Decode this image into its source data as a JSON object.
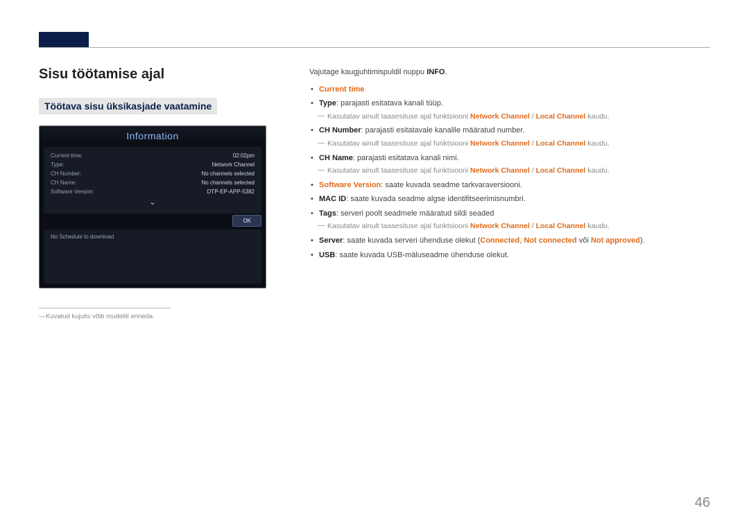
{
  "page_number": "46",
  "heading_main": "Sisu töötamise ajal",
  "heading_sub": "Töötava sisu üksikasjade vaatamine",
  "device": {
    "title": "Information",
    "rows": [
      {
        "label": "Current time:",
        "value": "02:02pm"
      },
      {
        "label": "Type:",
        "value": "Network Channel"
      },
      {
        "label": "CH Number:",
        "value": "No channels selected"
      },
      {
        "label": "CH Name:",
        "value": "No channels selected"
      },
      {
        "label": "Software Version:",
        "value": "DTP-EP-APP-5382"
      }
    ],
    "ok_label": "OK",
    "schedule_text": "No Schedule to download"
  },
  "footnote": "Kuvatud kujutis võib mudeliti erineda.",
  "intro_pre": "Vajutage kaugjuhtimispuldil nuppu ",
  "intro_bold": "INFO",
  "intro_post": ".",
  "items": [
    {
      "lead_orange": "Current time",
      "rest": ""
    },
    {
      "lead_bold": "Type",
      "rest": ": parajasti esitatava kanali tüüp.",
      "sub_pre": "Kasutatav ainult taasesituse ajal funktsiooni ",
      "sub_orange1": "Network Channel",
      "sub_mid": " / ",
      "sub_orange2": "Local Channel",
      "sub_post": " kaudu."
    },
    {
      "lead_bold": "CH Number",
      "rest": ": parajasti esitatavale kanalile määratud number.",
      "sub_pre": "Kasutatav ainult taasesituse ajal funktsiooni ",
      "sub_orange1": "Network Channel",
      "sub_mid": " / ",
      "sub_orange2": "Local Channel",
      "sub_post": " kaudu."
    },
    {
      "lead_bold": "CH Name",
      "rest": ": parajasti esitatava kanali nimi.",
      "sub_pre": "Kasutatav ainult taasesituse ajal funktsiooni ",
      "sub_orange1": "Network Channel",
      "sub_mid": " / ",
      "sub_orange2": "Local Channel",
      "sub_post": " kaudu."
    },
    {
      "lead_orange": "Software Version",
      "rest": ": saate kuvada seadme tarkvaraversiooni."
    },
    {
      "lead_bold": "MAC ID",
      "rest": ": saate kuvada seadme algse identifitseerimisnumbri."
    },
    {
      "lead_bold": "Tags",
      "rest": ": serveri poolt seadmele määratud sildi seaded",
      "sub_pre": "Kasutatav ainult taasesituse ajal funktsiooni ",
      "sub_orange1": "Network Channel",
      "sub_mid": " / ",
      "sub_orange2": "Local Channel",
      "sub_post": " kaudu."
    },
    {
      "lead_bold": "Server",
      "rest_pre": ": saate kuvada serveri ühenduse olekut (",
      "inline_orange1": "Connected",
      "inline_sep1": ", ",
      "inline_orange2": "Not connected",
      "inline_sep2": " või ",
      "inline_orange3": "Not approved",
      "rest_post": ")."
    },
    {
      "lead_bold": "USB",
      "rest": ": saate kuvada USB-mäluseadme ühenduse olekut."
    }
  ]
}
